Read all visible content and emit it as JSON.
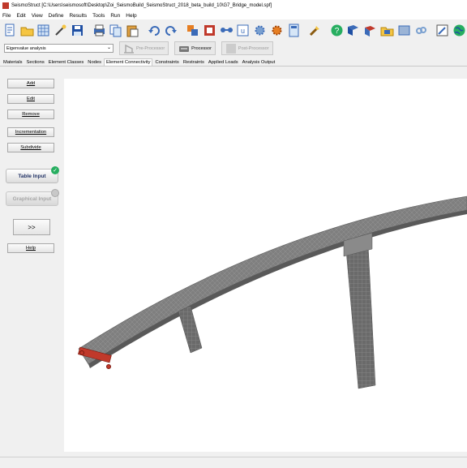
{
  "window": {
    "title": "SeismoStruct   [C:\\Users\\seismosoft\\Desktop\\Zoi_SeismoBuild_SeismoStruct_2018_beta_build_10\\G7_Bridge_model.spf]"
  },
  "menu": [
    "File",
    "Edit",
    "View",
    "Define",
    "Results",
    "Tools",
    "Run",
    "Help"
  ],
  "toolbar": {
    "icons": [
      "new-file-icon",
      "open-folder-icon",
      "grid-icon",
      "wand-icon",
      "save-icon",
      "print-icon",
      "copy-icon",
      "paste-icon",
      "undo-icon",
      "redo-icon",
      "edit-icon",
      "tool-icon",
      "connectivity-icon",
      "u-icon",
      "settings-icon",
      "gear-icon",
      "calculator-icon",
      "brush-icon",
      "help-icon",
      "book-icon",
      "books-icon",
      "folder-icon",
      "wiki-icon",
      "link-icon",
      "edit-doc-icon",
      "globe-icon"
    ]
  },
  "mode_bar": {
    "analysis_type": "Eigenvalue analysis",
    "pre_processor": "Pre-Processor",
    "processor": "Processor",
    "post_processor": "Post-Processor"
  },
  "tabs": [
    "Materials",
    "Sections",
    "Element Classes",
    "Nodes",
    "Element Connectivity",
    "Constraints",
    "Restraints",
    "Applied Loads",
    "Analysis Output"
  ],
  "active_tab": "Element Connectivity",
  "left_panel": {
    "add": "Add",
    "edit": "Edit",
    "remove": "Remove",
    "incrementation": "Incrementation",
    "subdivide": "Subdivide",
    "table_input": "Table Input",
    "graphical_input": "Graphical Input",
    "expand": ">>",
    "help": "Help"
  },
  "colors": {
    "window_bg": "#f0f0f0",
    "viewport_bg": "#ffffff",
    "structure": "#7d7d7d",
    "support": "#c0392b",
    "check": "#27ae60"
  }
}
